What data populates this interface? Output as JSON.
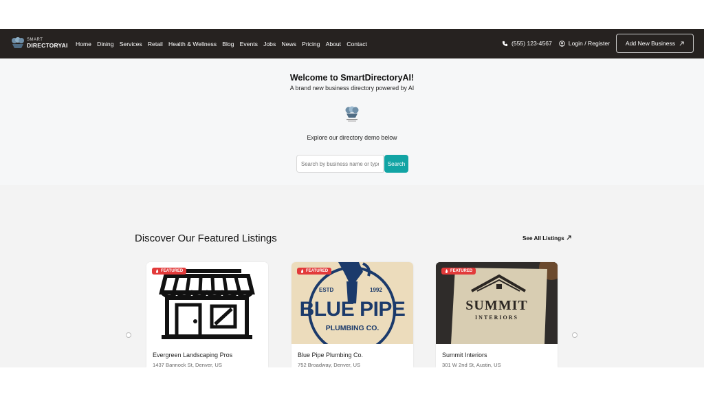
{
  "logo": {
    "line1": "SMART",
    "line2": "DIRECTORYAI"
  },
  "nav": [
    "Home",
    "Dining",
    "Services",
    "Retail",
    "Health & Wellness",
    "Blog",
    "Events",
    "Jobs",
    "News",
    "Pricing",
    "About",
    "Contact"
  ],
  "header": {
    "phone": "(555) 123-4567",
    "login": "Login / Register",
    "add_business": "Add New Business",
    "add_icon": "external-arrow-icon"
  },
  "hero": {
    "title": "Welcome to SmartDirectoryAI!",
    "subtitle": "A brand new business directory powered by AI",
    "explore": "Explore our directory demo below",
    "search_placeholder": "Search by business name or type",
    "search_button": "Search"
  },
  "featured": {
    "title": "Discover Our Featured Listings",
    "see_all": "See All Listings",
    "badge": "FEATURED",
    "cards": [
      {
        "name": "Evergreen Landscaping Pros",
        "address": "1437 Bannock St, Denver, US"
      },
      {
        "name": "Blue Pipe Plumbing Co.",
        "address": "752 Broadway, Denver, US",
        "logo_top": "ESTD",
        "logo_year": "1992",
        "logo_main": "BLUE PIPE",
        "logo_sub": "PLUMBING CO."
      },
      {
        "name": "Summit Interiors",
        "address": "301 W 2nd St, Austin, US",
        "logo_main": "SUMMIT",
        "logo_sub": "INTERIORS"
      }
    ]
  },
  "colors": {
    "navbar": "#262220",
    "accent": "#12a4a4",
    "badge": "#e23a3a",
    "navy": "#1b3a6b"
  }
}
